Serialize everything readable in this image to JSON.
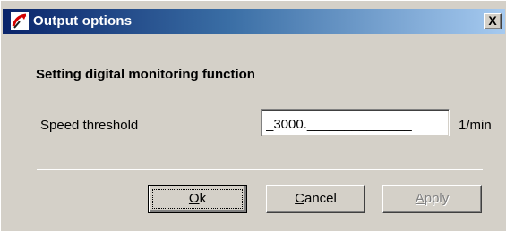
{
  "window": {
    "title": "Output options",
    "close_label": "X"
  },
  "content": {
    "heading": "Setting digital monitoring function",
    "field_label": "Speed threshold",
    "field_value": "_3000.______________",
    "unit": "1/min"
  },
  "buttons": {
    "ok": {
      "mnemonic": "O",
      "rest": "k"
    },
    "cancel": {
      "mnemonic": "C",
      "rest": "ancel"
    },
    "apply": {
      "mnemonic": "A",
      "rest": "pply"
    }
  }
}
